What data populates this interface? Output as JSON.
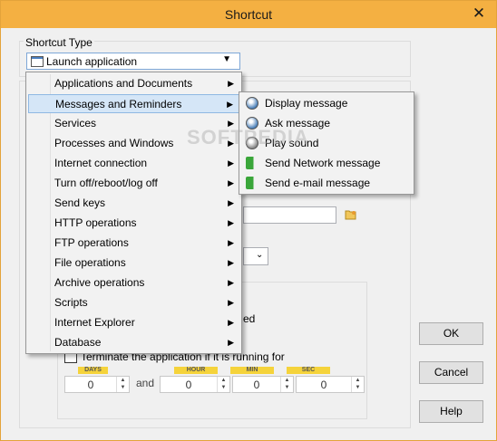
{
  "window": {
    "title": "Shortcut",
    "close_glyph": "✕"
  },
  "shortcut_type": {
    "group_label": "Shortcut Type",
    "selected": "Launch application",
    "dropdown_glyph": "▼"
  },
  "main_menu": {
    "items": [
      "Applications and Documents",
      "Messages and Reminders",
      "Services",
      "Processes and Windows",
      "Internet connection",
      "Turn off/reboot/log off",
      "Send keys",
      "HTTP operations",
      "FTP operations",
      "File operations",
      "Archive operations",
      "Scripts",
      "Internet Explorer",
      "Database"
    ],
    "selected_index": 1,
    "submenu_glyph": "▶"
  },
  "sub_menu": {
    "items": [
      {
        "label": "Display message",
        "icon": "display-message-icon",
        "color": "#4a7fb8"
      },
      {
        "label": "Ask message",
        "icon": "ask-message-icon",
        "color": "#4a7fb8"
      },
      {
        "label": "Play sound",
        "icon": "play-sound-icon",
        "color": "#888888"
      },
      {
        "label": "Send Network message",
        "icon": "network-arrow-icon",
        "color": "#3aa63a"
      },
      {
        "label": "Send e-mail message",
        "icon": "email-arrow-icon",
        "color": "#3aa63a"
      }
    ]
  },
  "watermark": "SOFTPEDIA",
  "background_form": {
    "partial_text": "ed",
    "terminate_label": "Terminate the application if it is running for",
    "timer": {
      "days_label": "DAYS",
      "days_value": "0",
      "and_label": "and",
      "hour_label": "HOUR",
      "hour_value": "0",
      "min_label": "MIN",
      "min_value": "0",
      "sec_label": "SEC",
      "sec_value": "0"
    }
  },
  "buttons": {
    "ok": "OK",
    "cancel": "Cancel",
    "help": "Help"
  },
  "colors": {
    "titlebar": "#f4b042",
    "menu_highlight": "#d5e6f7",
    "timer_label": "#f5d33b"
  }
}
